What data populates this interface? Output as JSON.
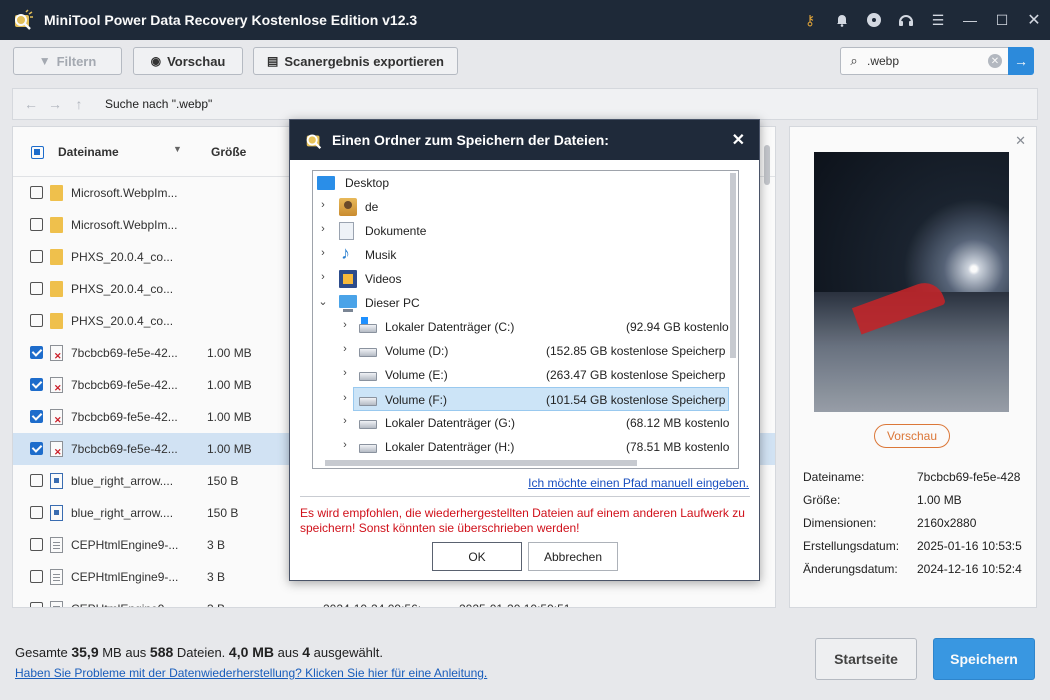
{
  "app": {
    "title": "MiniTool Power Data Recovery Kostenlose Edition v12.3",
    "window_icons": [
      "key-icon",
      "bell-icon",
      "disc-icon",
      "headset-icon",
      "menu-icon",
      "minimize-icon",
      "maximize-icon",
      "close-icon"
    ]
  },
  "toolbar": {
    "filter_label": "Filtern",
    "preview_label": "Vorschau",
    "export_label": "Scanergebnis exportieren",
    "search_value": ".webp"
  },
  "navbar": {
    "path": "Suche nach \".webp\""
  },
  "file_list": {
    "columns": [
      "Dateiname",
      "Größe"
    ],
    "rows": [
      {
        "name": "Microsoft.WebpIm...",
        "size": "",
        "c3": "",
        "c4": "",
        "checked": false,
        "icon": "folder"
      },
      {
        "name": "Microsoft.WebpIm...",
        "size": "",
        "c3": "",
        "c4": "",
        "checked": false,
        "icon": "folder"
      },
      {
        "name": "PHXS_20.0.4_co...",
        "size": "",
        "c3": "",
        "c4": "",
        "checked": false,
        "icon": "folder"
      },
      {
        "name": "PHXS_20.0.4_co...",
        "size": "",
        "c3": "",
        "c4": "",
        "checked": false,
        "icon": "folder"
      },
      {
        "name": "PHXS_20.0.4_co...",
        "size": "",
        "c3": "",
        "c4": "",
        "checked": false,
        "icon": "folder"
      },
      {
        "name": "7bcbcb69-fe5e-42...",
        "size": "1.00 MB",
        "c3": "",
        "c4": "",
        "checked": true,
        "icon": "deleted"
      },
      {
        "name": "7bcbcb69-fe5e-42...",
        "size": "1.00 MB",
        "c3": "",
        "c4": "",
        "checked": true,
        "icon": "deleted"
      },
      {
        "name": "7bcbcb69-fe5e-42...",
        "size": "1.00 MB",
        "c3": "",
        "c4": "",
        "checked": true,
        "icon": "deleted"
      },
      {
        "name": "7bcbcb69-fe5e-42...",
        "size": "1.00 MB",
        "c3": "",
        "c4": "",
        "checked": true,
        "icon": "deleted"
      },
      {
        "name": "blue_right_arrow....",
        "size": "150 B",
        "c3": "",
        "c4": "",
        "checked": false,
        "icon": "blue"
      },
      {
        "name": "blue_right_arrow....",
        "size": "150 B",
        "c3": "",
        "c4": "",
        "checked": false,
        "icon": "blue"
      },
      {
        "name": "CEPHtmlEngine9-...",
        "size": "3 B",
        "c3": "",
        "c4": "",
        "checked": false,
        "icon": "doc"
      },
      {
        "name": "CEPHtmlEngine9-...",
        "size": "3 B",
        "c3": "",
        "c4": "",
        "checked": false,
        "icon": "doc"
      },
      {
        "name": "CEPHtmlEngine9-...",
        "size": "3 B",
        "c3": "2024-10-24 09:56:...",
        "c4": "2025-01-20 10:59:51",
        "checked": false,
        "icon": "doc"
      }
    ]
  },
  "preview": {
    "button_label": "Vorschau",
    "meta": [
      {
        "label": "Dateiname:",
        "value": "7bcbcb69-fe5e-428"
      },
      {
        "label": "Größe:",
        "value": "1.00 MB"
      },
      {
        "label": "Dimensionen:",
        "value": "2160x2880"
      },
      {
        "label": "Erstellungsdatum:",
        "value": "2025-01-16 10:53:5"
      },
      {
        "label": "Änderungsdatum:",
        "value": "2024-12-16 10:52:4"
      }
    ]
  },
  "bottom": {
    "stat_prefix": "Gesamte ",
    "total_size": "35,9",
    "stat_mid1": " MB aus ",
    "total_count": "588",
    "stat_mid2": " Dateien.  ",
    "sel_size": "4,0 MB",
    "stat_mid3": " aus ",
    "sel_count": "4",
    "stat_suffix": " ausgewählt.",
    "help_link": "Haben Sie Probleme mit der Datenwiederherstellung? Klicken Sie hier für eine Anleitung.",
    "home_label": "Startseite",
    "save_label": "Speichern"
  },
  "dialog": {
    "title": "Einen Ordner zum Speichern der Dateien:",
    "tree": [
      {
        "label": "Desktop",
        "info": "",
        "level": 0,
        "arrow": "",
        "icon": "desktop"
      },
      {
        "label": "de",
        "info": "",
        "level": 1,
        "arrow": "›",
        "icon": "user"
      },
      {
        "label": "Dokumente",
        "info": "",
        "level": 1,
        "arrow": "›",
        "icon": "docs"
      },
      {
        "label": "Musik",
        "info": "",
        "level": 1,
        "arrow": "›",
        "icon": "music"
      },
      {
        "label": "Videos",
        "info": "",
        "level": 1,
        "arrow": "›",
        "icon": "video"
      },
      {
        "label": "Dieser PC",
        "info": "",
        "level": 1,
        "arrow": "⌄",
        "icon": "pc"
      },
      {
        "label": "Lokaler Datenträger (C:)",
        "info": "(92.94 GB kostenlo",
        "level": 2,
        "arrow": "›",
        "icon": "drive win"
      },
      {
        "label": "Volume (D:)",
        "info": "(152.85 GB kostenlose Speicherp",
        "level": 2,
        "arrow": "›",
        "icon": "drive"
      },
      {
        "label": "Volume (E:)",
        "info": "(263.47 GB kostenlose Speicherp",
        "level": 2,
        "arrow": "›",
        "icon": "drive"
      },
      {
        "label": "Volume (F:)",
        "info": "(101.54 GB kostenlose Speicherp",
        "level": 2,
        "arrow": "›",
        "icon": "drive",
        "selected": true
      },
      {
        "label": "Lokaler Datenträger (G:)",
        "info": "(68.12 MB kostenlo",
        "level": 2,
        "arrow": "›",
        "icon": "drive"
      },
      {
        "label": "Lokaler Datenträger (H:)",
        "info": "(78.51 MB kostenlo",
        "level": 2,
        "arrow": "›",
        "icon": "drive"
      }
    ],
    "manual_link": "Ich möchte einen Pfad manuell eingeben.",
    "warning": "Es wird empfohlen, die wiederhergestellten Dateien auf einem anderen Laufwerk zu speichern! Sonst könnten sie überschrieben werden!",
    "ok_label": "OK",
    "cancel_label": "Abbrechen"
  }
}
